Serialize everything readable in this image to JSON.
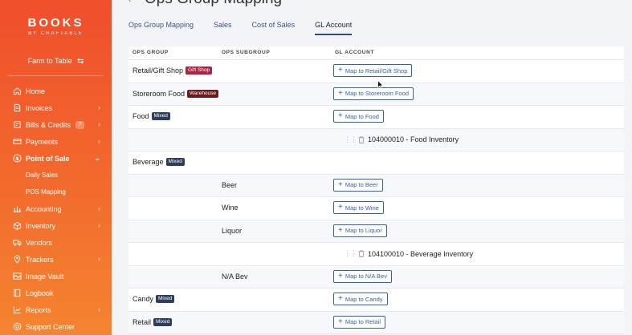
{
  "sidebar": {
    "logo": {
      "main": "BOOKS",
      "sub": "BY CRAFTABLE"
    },
    "location": "Farm to Table",
    "items": [
      {
        "label": "Home",
        "icon": "home-icon",
        "chevron": false
      },
      {
        "label": "Invoices",
        "icon": "invoice-icon",
        "chevron": true
      },
      {
        "label": "Bills & Credits",
        "icon": "bills-icon",
        "chevron": true,
        "badge": "?"
      },
      {
        "label": "Payments",
        "icon": "card-icon",
        "chevron": true
      },
      {
        "label": "Point of Sale",
        "icon": "dollar-icon",
        "chevron": true,
        "active": true
      },
      {
        "label": "Accounting",
        "icon": "accounting-icon",
        "chevron": true
      },
      {
        "label": "Inventory",
        "icon": "inventory-icon",
        "chevron": true
      },
      {
        "label": "Vendors",
        "icon": "truck-icon",
        "chevron": false
      },
      {
        "label": "Trackers",
        "icon": "pin-icon",
        "chevron": true
      },
      {
        "label": "Image Vault",
        "icon": "image-icon",
        "chevron": false
      },
      {
        "label": "Logbook",
        "icon": "logbook-icon",
        "chevron": false
      },
      {
        "label": "Reports",
        "icon": "chart-icon",
        "chevron": true
      },
      {
        "label": "Support Center",
        "icon": "support-icon",
        "chevron": false
      }
    ],
    "sub_items": [
      "Daily Sales",
      "POS Mapping"
    ]
  },
  "header": {
    "title": "Ops Group Mapping",
    "tabs": [
      "Ops Group Mapping",
      "Sales",
      "Cost of Sales",
      "GL Account"
    ],
    "active_tab": 3
  },
  "table": {
    "columns": [
      "OPS GROUP",
      "OPS SUBGROUP",
      "GL ACCOUNT"
    ],
    "rows": {
      "r0": {
        "group": "Retail/Gift Shop",
        "tag": "Gift Shop",
        "button": "Map to Retail/Gift Shop"
      },
      "r1": {
        "group": "Storeroom Food",
        "tag": "Warehouse",
        "button": "Map to Storeroom Food"
      },
      "r2": {
        "group": "Food",
        "tag": "Mixed",
        "button": "Map to Food"
      },
      "r3": {
        "gl": "104000010 - Food Inventory"
      },
      "r4": {
        "group": "Beverage",
        "tag": "Mixed"
      },
      "r5": {
        "subgroup": "Beer",
        "button": "Map to Beer"
      },
      "r6": {
        "subgroup": "Wine",
        "button": "Map to Wine"
      },
      "r7": {
        "subgroup": "Liquor",
        "button": "Map to Liquor"
      },
      "r8": {
        "gl": "104100010 - Beverage Inventory"
      },
      "r9": {
        "subgroup": "N/A Bev",
        "button": "Map to N/A Bev"
      },
      "r10": {
        "group": "Candy",
        "tag": "Mixed",
        "button": "Map to Candy"
      },
      "r11": {
        "group": "Retail",
        "tag": "Mixed",
        "button": "Map to Retail"
      }
    }
  },
  "colors": {
    "sidebar_top": "#f04e2b",
    "sidebar_bottom": "#f4842f",
    "accent": "#2f63b0",
    "tag_mixed": "#2c3e5c",
    "tag_gift": "#b0203f",
    "tag_warehouse": "#6b1b1b"
  }
}
